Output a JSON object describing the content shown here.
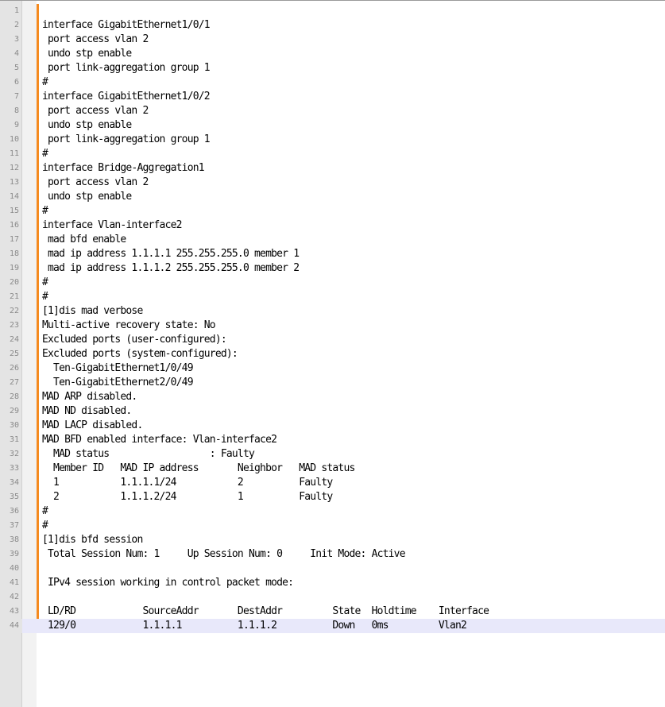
{
  "editor": {
    "current_line": 44,
    "lines": [
      "",
      "interface GigabitEthernet1/0/1",
      " port access vlan 2",
      " undo stp enable",
      " port link-aggregation group 1",
      "#",
      "interface GigabitEthernet1/0/2",
      " port access vlan 2",
      " undo stp enable",
      " port link-aggregation group 1",
      "#",
      "interface Bridge-Aggregation1",
      " port access vlan 2",
      " undo stp enable",
      "#",
      "interface Vlan-interface2",
      " mad bfd enable",
      " mad ip address 1.1.1.1 255.255.255.0 member 1",
      " mad ip address 1.1.1.2 255.255.255.0 member 2",
      "#",
      "#",
      "[1]dis mad verbose",
      "Multi-active recovery state: No",
      "Excluded ports (user-configured):",
      "Excluded ports (system-configured):",
      "  Ten-GigabitEthernet1/0/49",
      "  Ten-GigabitEthernet2/0/49",
      "MAD ARP disabled.",
      "MAD ND disabled.",
      "MAD LACP disabled.",
      "MAD BFD enabled interface: Vlan-interface2",
      "  MAD status                  : Faulty",
      "  Member ID   MAD IP address       Neighbor   MAD status",
      "  1           1.1.1.1/24           2          Faulty",
      "  2           1.1.1.2/24           1          Faulty",
      "#",
      "#",
      "[1]dis bfd session",
      " Total Session Num: 1     Up Session Num: 0     Init Mode: Active",
      "",
      " IPv4 session working in control packet mode:",
      "",
      " LD/RD            SourceAddr       DestAddr         State  Holdtime    Interface",
      " 129/0            1.1.1.1          1.1.1.2          Down   0ms         Vlan2"
    ]
  }
}
